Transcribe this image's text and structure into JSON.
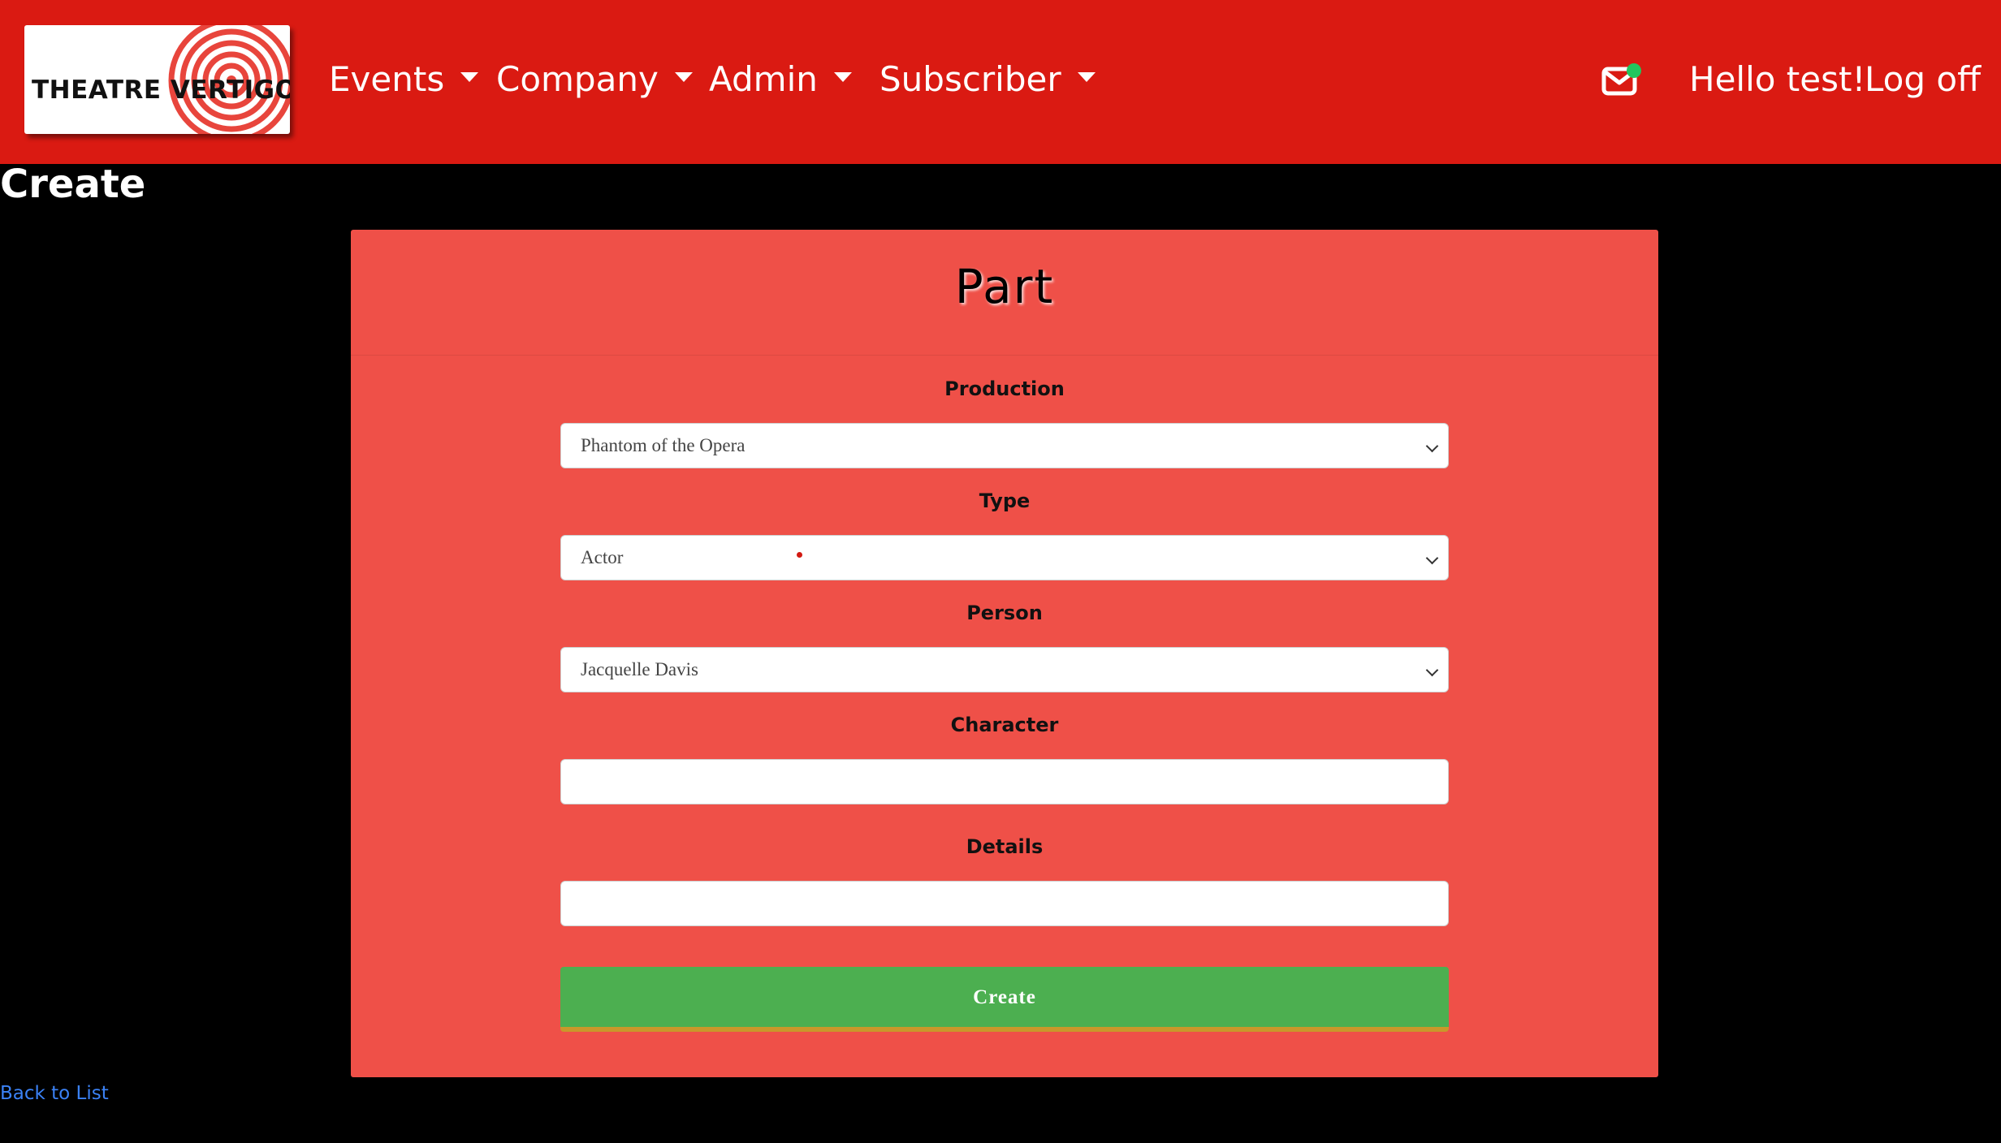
{
  "nav": {
    "brand": "THEATRE VERTIGO",
    "menu": [
      {
        "label": "Events"
      },
      {
        "label": "Company"
      },
      {
        "label": "Admin"
      },
      {
        "label": "Subscriber"
      }
    ],
    "greeting": "Hello test!",
    "logoff": "Log off",
    "mail_icon": "envelope-icon",
    "notification_color": "#22c55e"
  },
  "page": {
    "heading": "Create",
    "back_link": "Back to List"
  },
  "form": {
    "title": "Part",
    "fields": [
      {
        "label": "Production",
        "type": "select",
        "value": "Phantom of the Opera"
      },
      {
        "label": "Type",
        "type": "select",
        "value": "Actor"
      },
      {
        "label": "Person",
        "type": "select",
        "value": "Jacquelle Davis"
      },
      {
        "label": "Character",
        "type": "text",
        "value": ""
      },
      {
        "label": "Details",
        "type": "text",
        "value": ""
      }
    ],
    "submit_label": "Create"
  },
  "colors": {
    "navbar": "#da1a12",
    "card": "#ef5048",
    "button": "#4caf50",
    "link": "#3b82f6"
  }
}
